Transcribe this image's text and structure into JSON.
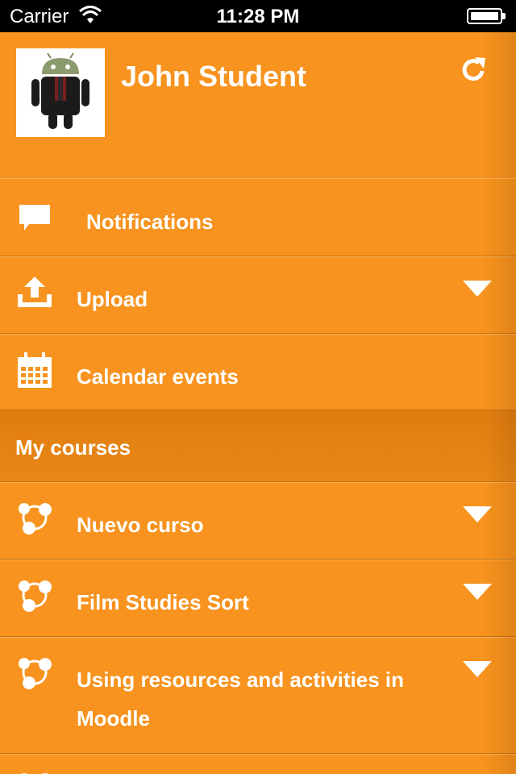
{
  "status_bar": {
    "carrier": "Carrier",
    "time": "11:28 PM"
  },
  "profile": {
    "name": "John Student",
    "avatar_icon": "android-avatar-icon",
    "refresh_icon": "refresh-icon"
  },
  "menu": {
    "items": [
      {
        "label": "Notifications",
        "icon": "speech-bubble-icon"
      },
      {
        "label": "Upload",
        "icon": "upload-icon",
        "expandable": true
      },
      {
        "label": "Calendar events",
        "icon": "calendar-icon"
      }
    ]
  },
  "courses": {
    "header": "My courses",
    "items": [
      {
        "label": "Nuevo curso",
        "icon": "moodle-course-icon",
        "expandable": true
      },
      {
        "label": "Film Studies Sort",
        "icon": "moodle-course-icon",
        "expandable": true
      },
      {
        "label_line1": "Using resources and activities in",
        "label_line2": "Moodle",
        "icon": "moodle-course-icon",
        "expandable": true
      }
    ]
  },
  "colors": {
    "accent": "#f7931e",
    "section_bg": "#e48214",
    "text": "#ffffff"
  }
}
